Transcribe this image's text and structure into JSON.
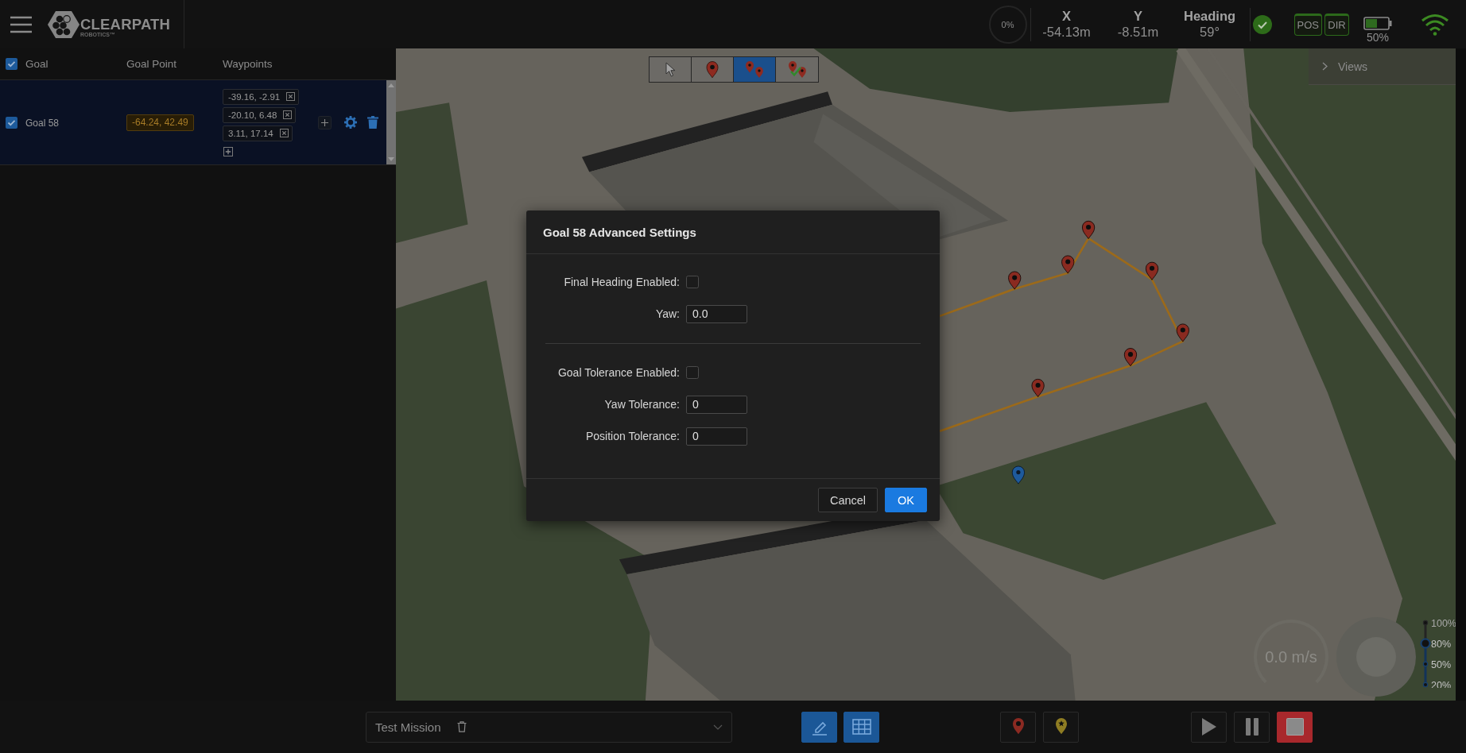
{
  "header": {
    "brand": {
      "name": "CLEARPATH",
      "tagline": "ROBOTICS™"
    },
    "progress": {
      "reading": "0%"
    },
    "pose": [
      {
        "label": "X",
        "value": "-54.13m"
      },
      {
        "label": "Y",
        "value": "-8.51m"
      },
      {
        "label": "Heading",
        "value": "59°"
      }
    ],
    "localization": [
      {
        "label": "POS",
        "on": true
      },
      {
        "label": "DIR",
        "on": true
      }
    ],
    "battery": {
      "reading": "50%"
    }
  },
  "goal_table": {
    "all_checked": true,
    "columns": [
      "Goal",
      "Goal Point",
      "Waypoints"
    ],
    "rows": [
      {
        "selected": true,
        "checked": true,
        "name": "Goal 58",
        "goal_point": "-64.24, 42.49",
        "waypoints": [
          "-39.16, -2.91",
          "-20.10, 6.48",
          "3.11, 17.14"
        ]
      }
    ]
  },
  "map": {
    "tools": [
      {
        "kind": "pointer",
        "selected": false
      },
      {
        "kind": "pin",
        "selected": false
      },
      {
        "kind": "pins",
        "selected": true
      },
      {
        "kind": "pins-check",
        "selected": false
      }
    ],
    "views_panel": {
      "label": "Views",
      "expanded": false
    },
    "speed": {
      "reading": "0.0 m/s"
    },
    "speed_limits": [
      {
        "label": "100%",
        "selected": false
      },
      {
        "label": "80%",
        "selected": true
      },
      {
        "label": "50%",
        "selected": false
      },
      {
        "label": "20%",
        "selected": false
      }
    ]
  },
  "dialog": {
    "title": "Goal 58 Advanced Settings",
    "sections": [
      {
        "fields": [
          {
            "kind": "checkbox",
            "label": "Final Heading Enabled:",
            "checked": false
          },
          {
            "kind": "input",
            "label": "Yaw:",
            "value": "0.0"
          }
        ]
      },
      {
        "fields": [
          {
            "kind": "checkbox",
            "label": "Goal Tolerance Enabled:",
            "checked": false
          },
          {
            "kind": "input",
            "label": "Yaw Tolerance:",
            "value": "0"
          },
          {
            "kind": "input",
            "label": "Position Tolerance:",
            "value": "0"
          }
        ]
      }
    ],
    "buttons": [
      {
        "kind": "secondary",
        "label": "Cancel"
      },
      {
        "kind": "primary",
        "label": "OK"
      }
    ]
  },
  "bottom_bar": {
    "mission": {
      "value": "Test Mission"
    },
    "view_buttons": [
      {
        "kind": "edit",
        "selected": true
      },
      {
        "kind": "table",
        "selected": true
      }
    ],
    "marker_buttons": [
      {
        "kind": "pin"
      },
      {
        "kind": "star-pin"
      }
    ],
    "playback": [
      {
        "kind": "play"
      },
      {
        "kind": "pause"
      },
      {
        "kind": "stop"
      }
    ]
  }
}
